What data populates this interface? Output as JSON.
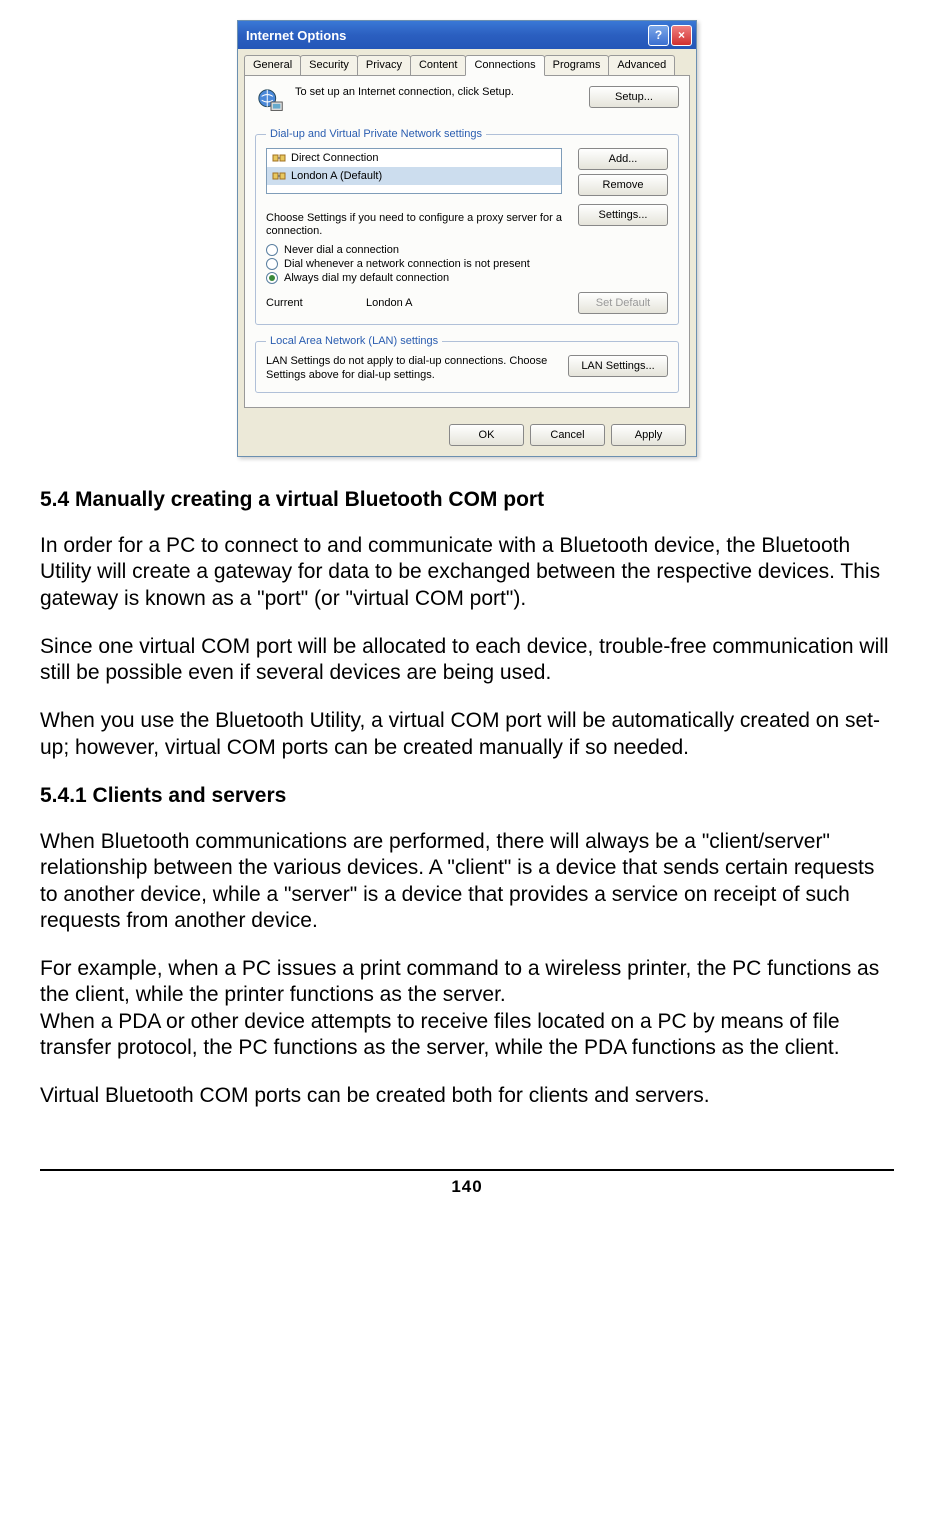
{
  "dialog": {
    "title": "Internet Options",
    "tabs": [
      "General",
      "Security",
      "Privacy",
      "Content",
      "Connections",
      "Programs",
      "Advanced"
    ],
    "setup_text": "To set up an Internet connection, click Setup.",
    "setup_btn": "Setup...",
    "group_dialup": {
      "legend": "Dial-up and Virtual Private Network settings",
      "items": [
        {
          "icon": "conn-icon",
          "label": "Direct Connection",
          "selected": false
        },
        {
          "icon": "conn-icon",
          "label": "London A (Default)",
          "selected": true
        }
      ],
      "add_btn": "Add...",
      "remove_btn": "Remove",
      "settings_caption": "Choose Settings if you need to configure a proxy server for a connection.",
      "settings_btn": "Settings...",
      "radios": [
        {
          "label": "Never dial a connection",
          "checked": false,
          "accel": "c"
        },
        {
          "label": "Dial whenever a network connection is not present",
          "checked": false,
          "accel": "w"
        },
        {
          "label": "Always dial my default connection",
          "checked": true,
          "accel": "o"
        }
      ],
      "current_label": "Current",
      "current_value": "London A",
      "set_default_btn": "Set Default"
    },
    "group_lan": {
      "legend": "Local Area Network (LAN) settings",
      "caption": "LAN Settings do not apply to dial-up connections. Choose Settings above for dial-up settings.",
      "btn": "LAN Settings..."
    },
    "bottom": {
      "ok": "OK",
      "cancel": "Cancel",
      "apply": "Apply"
    }
  },
  "doc": {
    "h54": "5.4  Manually creating a virtual Bluetooth COM port",
    "p1": "In order for a PC to connect to and communicate with a Bluetooth device, the Bluetooth Utility will create a gateway for data to be exchanged between the respective devices. This gateway is known as a \"port\" (or \"virtual COM port\").",
    "p2": "Since one virtual COM port will be allocated to each device, trouble-free communication will still be possible even if several devices are being used.",
    "p3": "When you use the Bluetooth Utility, a virtual COM port will be automatically created on set-up; however, virtual COM ports can be created manually if so needed.",
    "h541": "5.4.1    Clients and servers",
    "p4": "When Bluetooth communications are performed, there will always be a \"client/server\" relationship between the various devices. A \"client\" is a device that sends certain requests to another device, while a \"server\" is a device that provides a service on receipt of such requests from another device.",
    "p5": "For example, when a PC issues a print command to a wireless printer, the PC functions as the client, while the printer functions as the server.\nWhen a PDA or other device attempts to receive files located on a PC by means of file transfer protocol, the PC functions as the server, while the PDA functions as the client.",
    "p6": "Virtual Bluetooth COM ports can be created both for clients and servers.",
    "page_number": "140"
  }
}
